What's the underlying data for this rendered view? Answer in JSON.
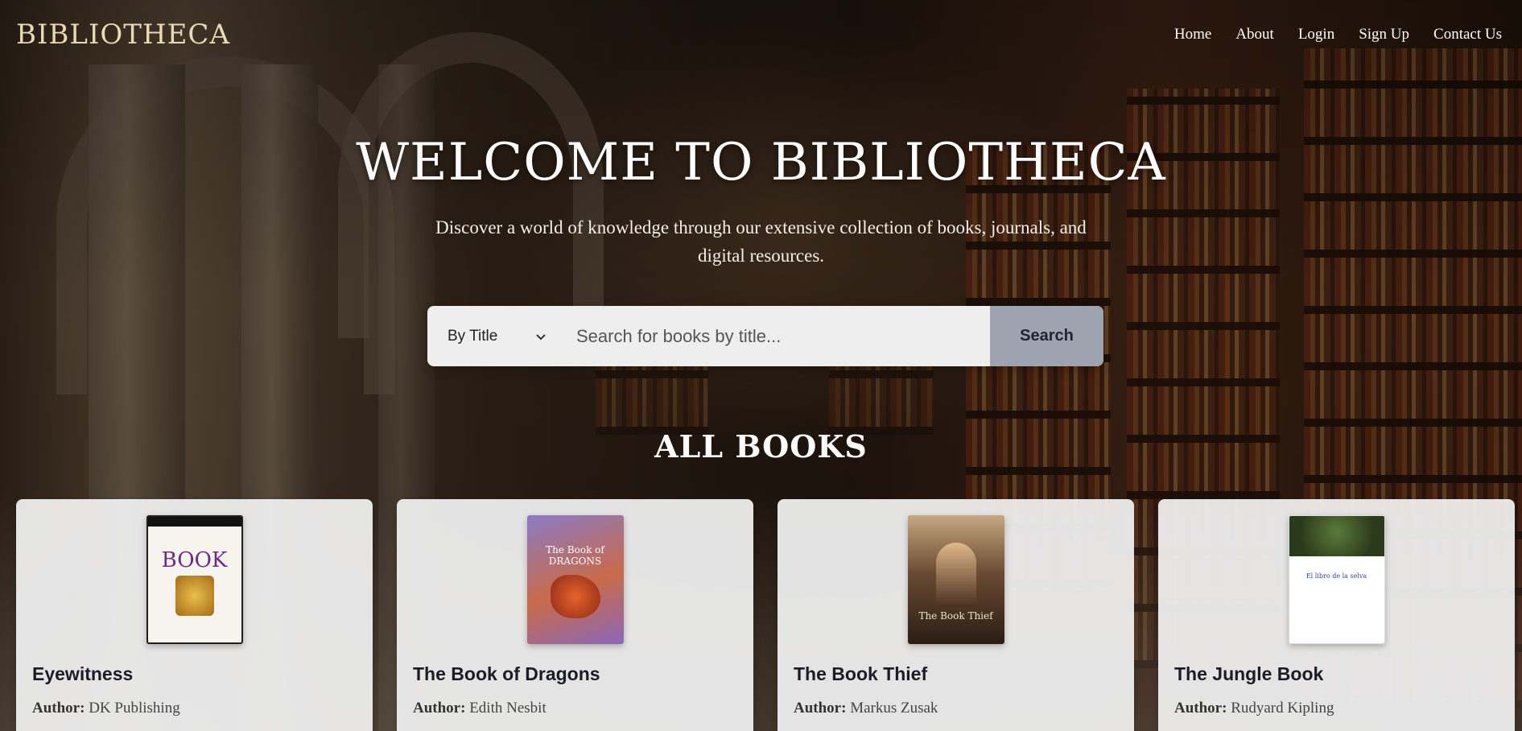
{
  "header": {
    "brand": "BIBLIOTHECA",
    "nav": [
      "Home",
      "About",
      "Login",
      "Sign Up",
      "Contact Us"
    ]
  },
  "hero": {
    "title": "Welcome to Bibliotheca",
    "subtitle": "Discover a world of knowledge through our extensive collection of books, journals, and digital resources."
  },
  "search": {
    "filter_selected": "By Title",
    "placeholder": "Search for books by title...",
    "button_label": "Search",
    "chevron_icon": "chevron-down-icon"
  },
  "books_section": {
    "title": "All Books",
    "author_label": "Author:",
    "books": [
      {
        "title": "Eyewitness",
        "author": "DK Publishing",
        "cover_text": "BOOK"
      },
      {
        "title": "The Book of Dragons",
        "author": "Edith Nesbit",
        "cover_text": "The Book of DRAGONS"
      },
      {
        "title": "The Book Thief",
        "author": "Markus Zusak",
        "cover_text": "The Book Thief"
      },
      {
        "title": "The Jungle Book",
        "author": "Rudyard Kipling",
        "cover_text": "El libro de la selva"
      }
    ]
  },
  "colors": {
    "brand": "#e9d8b4",
    "search_button": "#9ea3b0",
    "card_bg": "#eeeeee"
  }
}
